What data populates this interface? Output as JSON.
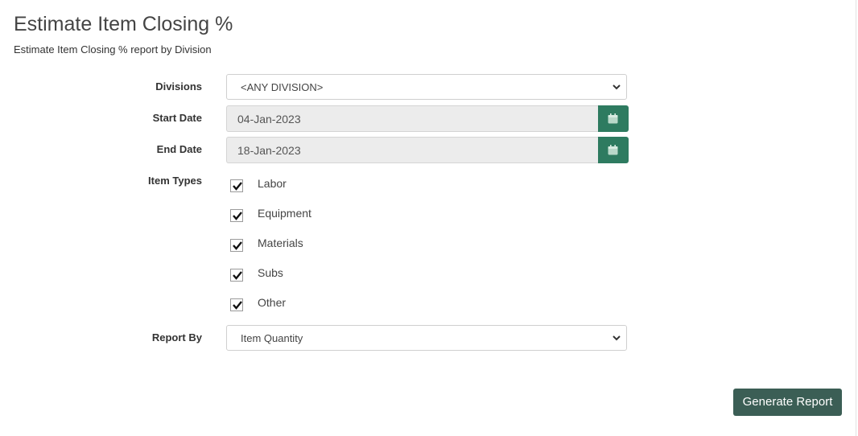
{
  "header": {
    "title": "Estimate Item Closing %",
    "subtitle": "Estimate Item Closing % report by Division"
  },
  "form": {
    "divisions": {
      "label": "Divisions",
      "selected": "<ANY DIVISION>"
    },
    "start_date": {
      "label": "Start Date",
      "value": "04-Jan-2023",
      "icon": "calendar-icon"
    },
    "end_date": {
      "label": "End Date",
      "value": "18-Jan-2023",
      "icon": "calendar-icon"
    },
    "item_types": {
      "label": "Item Types",
      "options": [
        {
          "label": "Labor",
          "checked": true
        },
        {
          "label": "Equipment",
          "checked": true
        },
        {
          "label": "Materials",
          "checked": true
        },
        {
          "label": "Subs",
          "checked": true
        },
        {
          "label": "Other",
          "checked": true
        }
      ]
    },
    "report_by": {
      "label": "Report By",
      "selected": "Item Quantity"
    }
  },
  "actions": {
    "generate_label": "Generate Report"
  },
  "colors": {
    "calendar_button": "#2e7b60",
    "generate_button": "#3b5e55",
    "date_input_bg": "#ececec"
  }
}
